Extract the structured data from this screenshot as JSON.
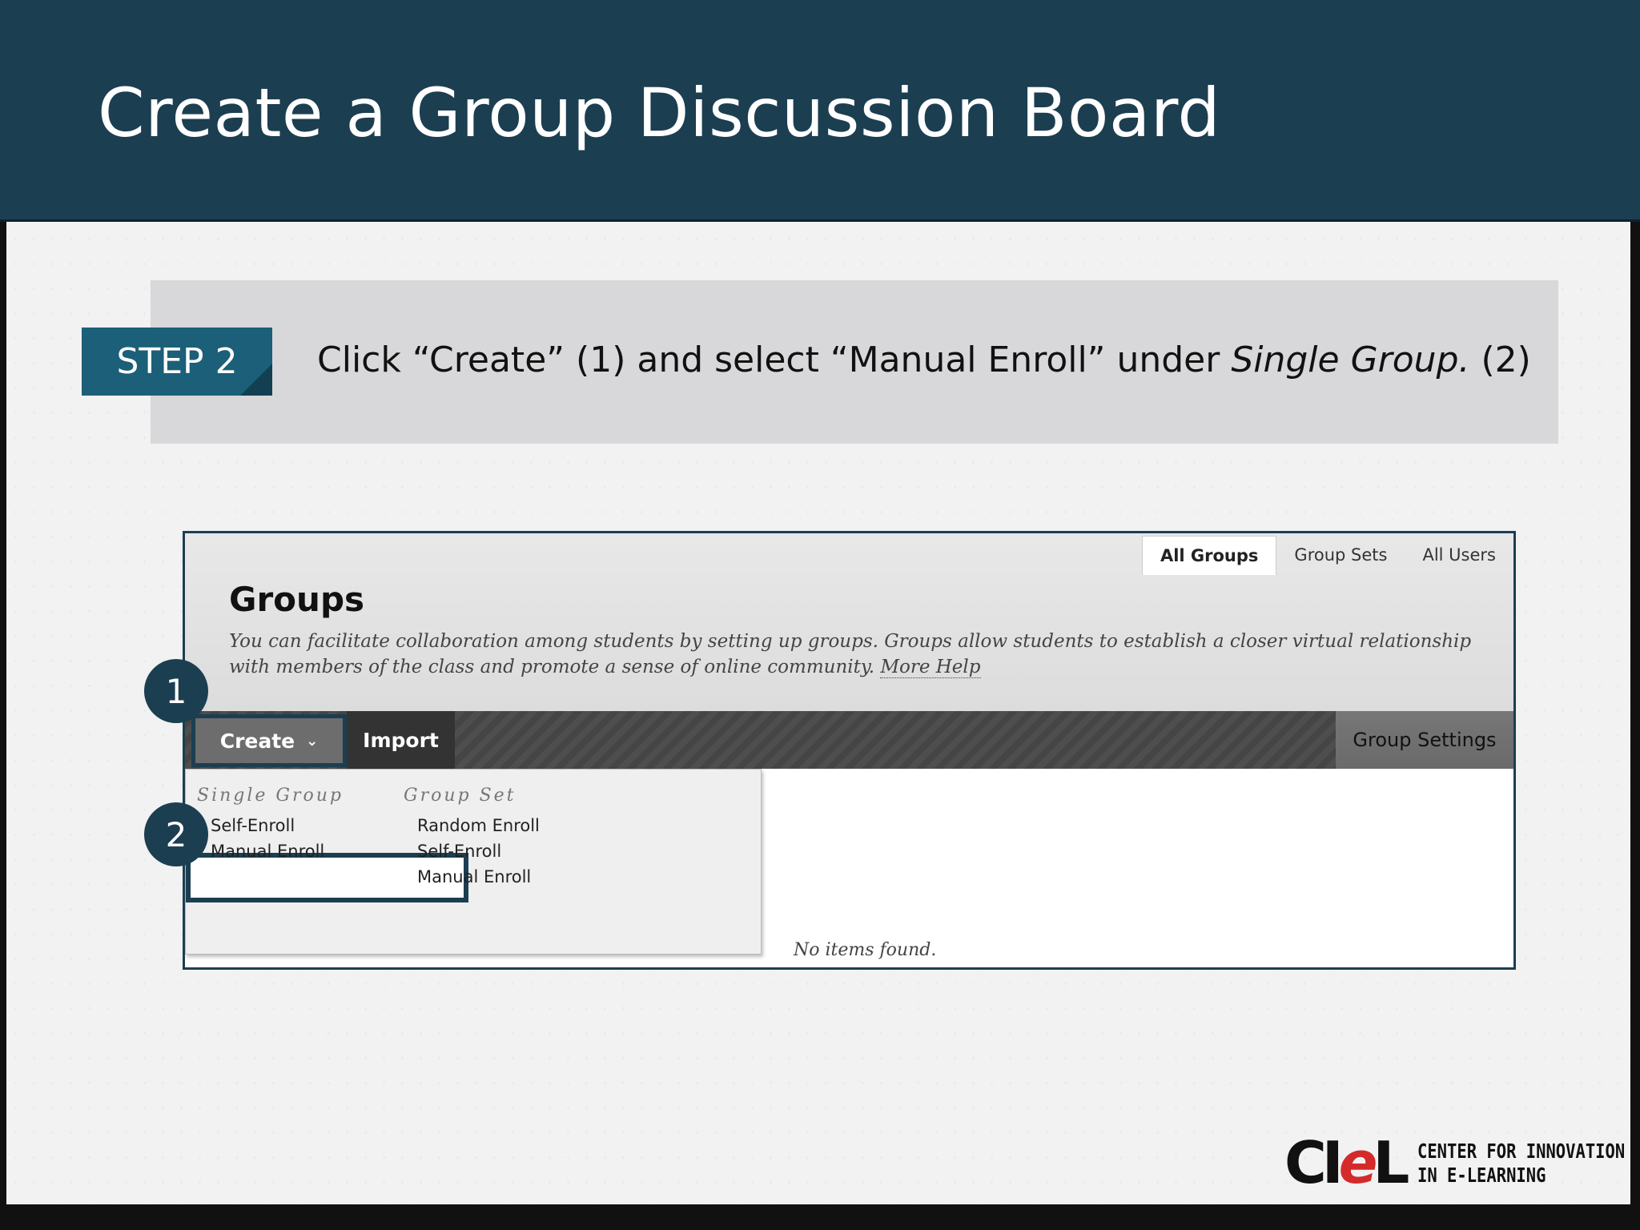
{
  "slide": {
    "title": "Create a Group Discussion Board",
    "step_label": "STEP 2",
    "instruction": {
      "part1": "Click “Create” (1) and select “Manual Enroll” under ",
      "part_italic": "Single Group.",
      "part2": " (2)"
    }
  },
  "screenshot": {
    "tabs": [
      {
        "label": "All Groups",
        "active": true
      },
      {
        "label": "Group Sets",
        "active": false
      },
      {
        "label": "All Users",
        "active": false
      }
    ],
    "page_title": "Groups",
    "description": "You can facilitate collaboration among students by setting up groups. Groups allow students to establish a closer virtual relationship with members of the class and promote a sense of online community.",
    "more_help": "More Help",
    "toolbar": {
      "create_label": "Create",
      "import_label": "Import",
      "group_settings_label": "Group Settings"
    },
    "dropdown": {
      "single_group_heading": "Single Group",
      "single_group_items": [
        "Self-Enroll",
        "Manual Enroll"
      ],
      "group_set_heading": "Group Set",
      "group_set_items": [
        "Random Enroll",
        "Self-Enroll",
        "Manual Enroll"
      ]
    },
    "empty_message": "No items found."
  },
  "callouts": [
    "1",
    "2"
  ],
  "logo": {
    "mark_c": "C",
    "mark_i": "I",
    "mark_e": "e",
    "mark_l": "L",
    "line1": "CENTER FOR INNOVATION",
    "line2": "IN E-LEARNING"
  },
  "colors": {
    "title_bar": "#1c3e51",
    "step_badge": "#1c5f79",
    "highlight_border": "#1c3e51",
    "logo_red": "#d42a2a"
  }
}
